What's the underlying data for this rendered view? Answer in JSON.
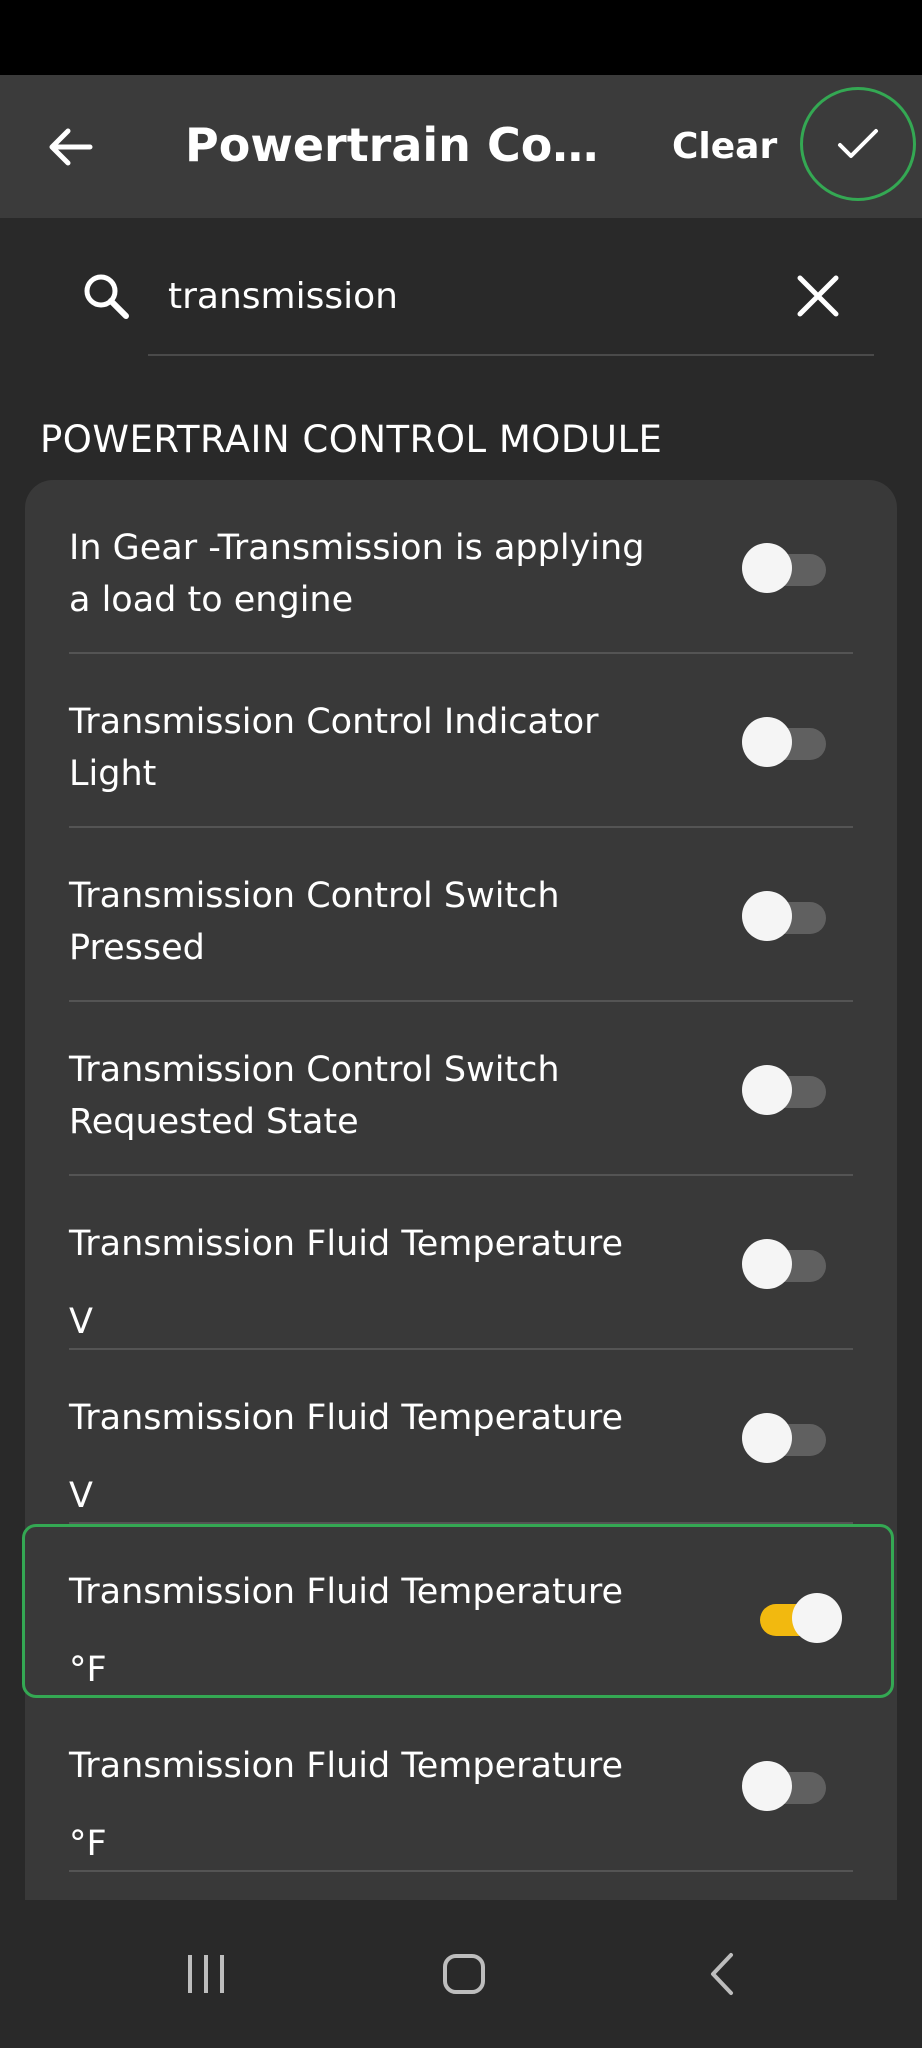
{
  "app_bar": {
    "title": "Powertrain Contr...",
    "clear_label": "Clear"
  },
  "search": {
    "value": "transmission",
    "placeholder": ""
  },
  "section": {
    "title": "POWERTRAIN CONTROL MODULE"
  },
  "items": [
    {
      "line1": "In Gear -Transmission is applying",
      "line2": "a load to engine",
      "enabled": false
    },
    {
      "line1": "Transmission Control Indicator",
      "line2": "Light",
      "enabled": false
    },
    {
      "line1": "Transmission Control Switch",
      "line2": "Pressed",
      "enabled": false
    },
    {
      "line1": "Transmission Control Switch",
      "line2": "Requested State",
      "enabled": false
    },
    {
      "line1": "Transmission Fluid Temperature",
      "line2": "V",
      "enabled": false
    },
    {
      "line1": "Transmission Fluid Temperature",
      "line2": "V",
      "enabled": false
    },
    {
      "line1": "Transmission Fluid Temperature",
      "line2": "°F",
      "enabled": true
    },
    {
      "line1": "Transmission Fluid Temperature",
      "line2": "°F",
      "enabled": false
    }
  ],
  "colors": {
    "accent_selected_border": "#34a853",
    "toggle_on": "#f2b90f"
  }
}
